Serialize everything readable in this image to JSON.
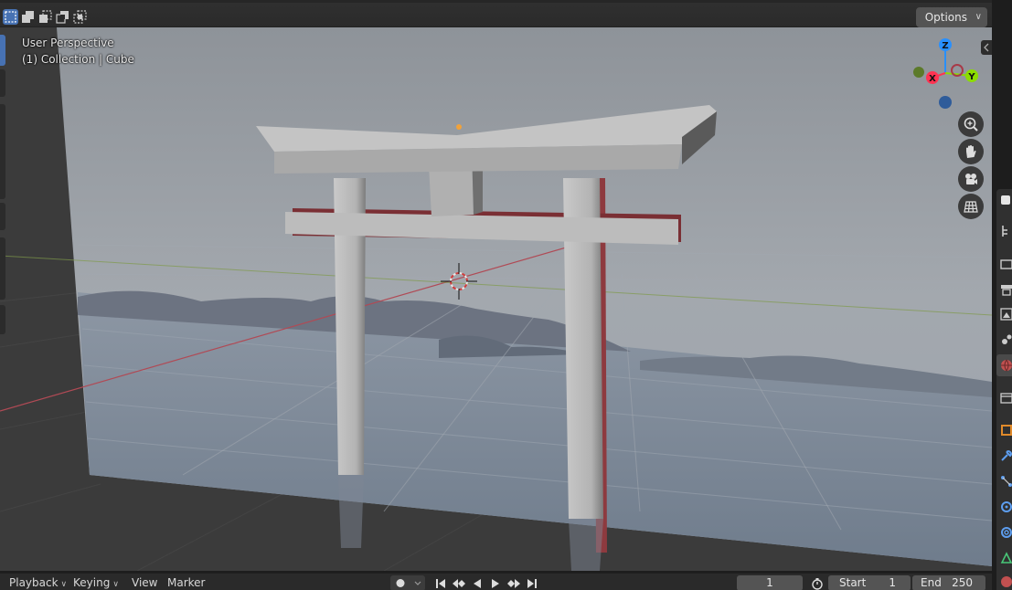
{
  "viewport": {
    "view_name": "User Perspective",
    "collection_line": "(1) Collection | Cube",
    "options_label": "Options"
  },
  "header": {
    "select_modes": [
      "select-box-icon",
      "mode-new-icon",
      "mode-extend-icon",
      "mode-subtract-icon",
      "mode-intersect-icon"
    ]
  },
  "gizmo": {
    "axes": [
      "X",
      "Y",
      "Z"
    ],
    "colors": {
      "x": "#ff3352",
      "y": "#8bdc00",
      "z": "#2890ff"
    }
  },
  "nav_tools": [
    "zoom-icon",
    "pan-hand-icon",
    "camera-icon",
    "ortho-grid-icon"
  ],
  "properties_tabs": [
    "tool-icon",
    "render-icon",
    "output-icon",
    "view-layer-icon",
    "scene-icon",
    "world-icon",
    "collection-icon",
    "object-icon",
    "modifier-icon",
    "particles-icon",
    "physics-icon",
    "constraints-icon",
    "data-icon",
    "material-icon"
  ],
  "timeline": {
    "playback_label": "Playback",
    "keying_label": "Keying",
    "view_label": "View",
    "marker_label": "Marker",
    "current_frame": "1",
    "start_label": "Start",
    "start_value": "1",
    "end_label": "End",
    "end_value": "250"
  },
  "colors": {
    "accent": "#4772b3",
    "background": "#1d1d1d"
  }
}
